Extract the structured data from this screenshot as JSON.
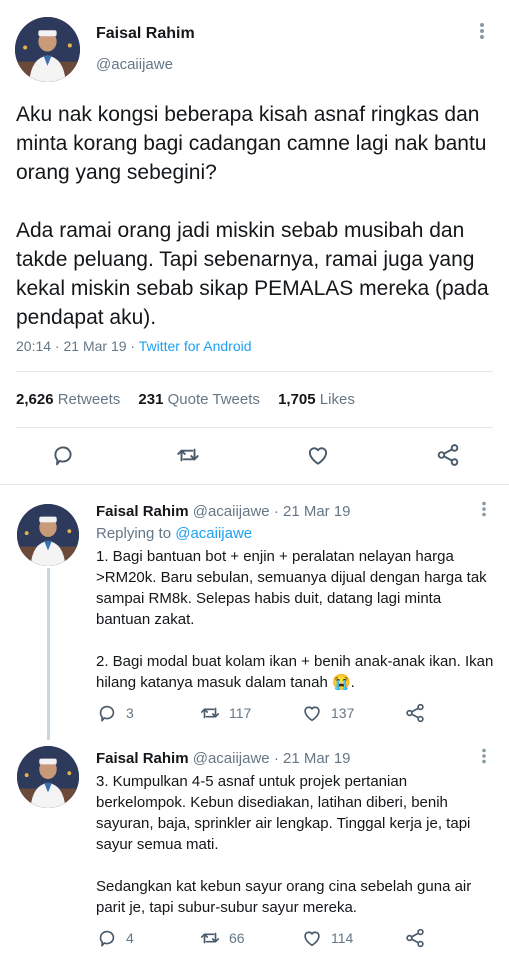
{
  "main_tweet": {
    "author_name": "Faisal Rahim",
    "handle": "@acaiijawe",
    "text": "Aku nak kongsi beberapa kisah asnaf ringkas dan minta korang bagi cadangan camne lagi nak bantu orang yang sebegini?\n\nAda ramai orang jadi miskin sebab musibah dan takde peluang. Tapi sebenarnya, ramai juga yang kekal miskin sebab sikap PEMALAS mereka (pada pendapat aku).",
    "timestamp": "20:14 · 21 Mar 19 · ",
    "source": "Twitter for Android",
    "stats": {
      "retweets_count": "2,626",
      "retweets_label": "Retweets",
      "quotes_count": "231",
      "quotes_label": "Quote Tweets",
      "likes_count": "1,705",
      "likes_label": "Likes"
    },
    "actions": [
      "reply-icon",
      "retweet-icon",
      "like-icon",
      "share-icon"
    ]
  },
  "replies": [
    {
      "author_name": "Faisal Rahim",
      "handle_date": "@acaiijawe · 21 Mar 19",
      "replying_label": "Replying to ",
      "replying_to": "@acaiijawe",
      "text": "1. Bagi bantuan bot + enjin + peralatan nelayan harga >RM20k. Baru sebulan, semuanya dijual dengan harga tak sampai RM8k. Selepas habis duit, datang lagi minta bantuan zakat.\n\n2. Bagi modal buat kolam ikan + benih anak-anak ikan. Ikan hilang katanya masuk dalam tanah 😭.",
      "reply_count": "3",
      "retweet_count": "117",
      "like_count": "137"
    },
    {
      "author_name": "Faisal Rahim",
      "handle_date": "@acaiijawe · 21 Mar 19",
      "text": "3. Kumpulkan 4-5 asnaf untuk projek pertanian berkelompok. Kebun disediakan, latihan diberi, benih sayuran, baja, sprinkler air lengkap. Tinggal kerja je, tapi sayur semua mati.\n\nSedangkan kat kebun sayur orang cina sebelah guna air parit je, tapi subur-subur sayur mereka.",
      "reply_count": "4",
      "retweet_count": "66",
      "like_count": "114"
    }
  ],
  "colors": {
    "text": "#14171a",
    "secondary": "#657786",
    "link": "#1da1f2",
    "icon": "#4a5a6a",
    "divider": "#e1e8ed",
    "thread_line": "#ccd6dd"
  }
}
